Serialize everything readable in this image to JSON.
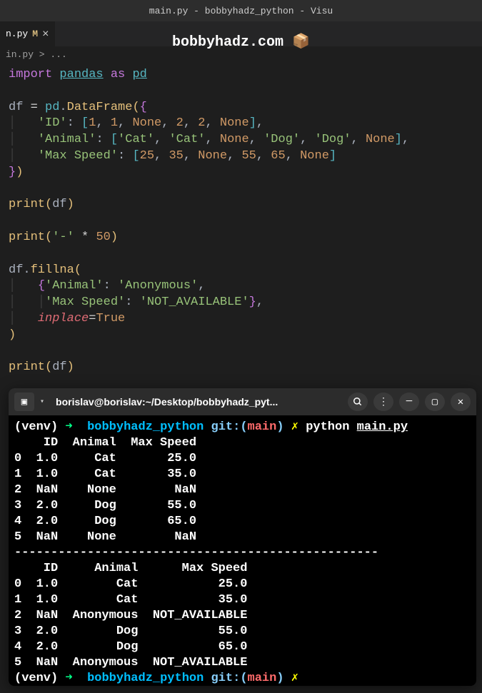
{
  "title_bar": "main.py - bobbyhadz_python - Visu",
  "tab": {
    "name": "n.py",
    "modified_indicator": "M",
    "close": "×"
  },
  "watermark": "bobbyhadz.com 📦",
  "breadcrumb": "in.py > ...",
  "code": {
    "l1_import": "import",
    "l1_pandas": "pandas",
    "l1_as": "as",
    "l1_pd": "pd",
    "l3_df": "df",
    "l3_eq": "=",
    "l3_pd": "pd",
    "l3_dot": ".",
    "l3_dataframe": "DataFrame",
    "l3_open": "({",
    "l4_id": "'ID'",
    "l4_colon": ":",
    "l4_open": "[",
    "l4_1a": "1",
    "l4_1b": "1",
    "l4_none": "None",
    "l4_2a": "2",
    "l4_2b": "2",
    "l4_none2": "None",
    "l4_close": "],",
    "l5_animal": "'Animal'",
    "l5_cat1": "'Cat'",
    "l5_cat2": "'Cat'",
    "l5_none": "None",
    "l5_dog1": "'Dog'",
    "l5_dog2": "'Dog'",
    "l5_none2": "None",
    "l5_close": "],",
    "l6_maxspeed": "'Max Speed'",
    "l6_25": "25",
    "l6_35": "35",
    "l6_none1": "None",
    "l6_55": "55",
    "l6_65": "65",
    "l6_none2": "None",
    "l6_close": "]",
    "l7_close": "})",
    "l9_print": "print",
    "l9_df": "df",
    "l11_print": "print",
    "l11_dash": "'-'",
    "l11_star": "*",
    "l11_50": "50",
    "l13_df": "df",
    "l13_fillna": "fillna",
    "l14_animal": "'Animal'",
    "l14_anonymous": "'Anonymous'",
    "l15_maxspeed": "'Max Speed'",
    "l15_notavail": "'NOT_AVAILABLE'",
    "l16_inplace": "inplace",
    "l16_true": "True",
    "l19_print": "print",
    "l19_df": "df"
  },
  "terminal": {
    "title": "borislav@borislav:~/Desktop/bobbyhadz_pyt...",
    "prompt1_venv": "(venv)",
    "prompt1_arrow": "➜",
    "prompt1_dir": "bobbyhadz_python",
    "prompt1_git": "git:(",
    "prompt1_branch": "main",
    "prompt1_gitclose": ")",
    "prompt1_lightning": "✗",
    "prompt1_cmd": "python",
    "prompt1_file": "main.py",
    "output_header": "    ID  Animal  Max Speed",
    "output_r0": "0  1.0     Cat       25.0",
    "output_r1": "1  1.0     Cat       35.0",
    "output_r2": "2  NaN    None        NaN",
    "output_r3": "3  2.0     Dog       55.0",
    "output_r4": "4  2.0     Dog       65.0",
    "output_r5": "5  NaN    None        NaN",
    "output_sep": "--------------------------------------------------",
    "output2_header": "    ID     Animal      Max Speed",
    "output2_r0": "0  1.0        Cat           25.0",
    "output2_r1": "1  1.0        Cat           35.0",
    "output2_r2": "2  NaN  Anonymous  NOT_AVAILABLE",
    "output2_r3": "3  2.0        Dog           55.0",
    "output2_r4": "4  2.0        Dog           65.0",
    "output2_r5": "5  NaN  Anonymous  NOT_AVAILABLE",
    "prompt2_venv": "(venv)",
    "prompt2_arrow": "➜",
    "prompt2_dir": "bobbyhadz_python",
    "prompt2_git": "git:(",
    "prompt2_branch": "main",
    "prompt2_gitclose": ")",
    "prompt2_lightning": "✗"
  }
}
